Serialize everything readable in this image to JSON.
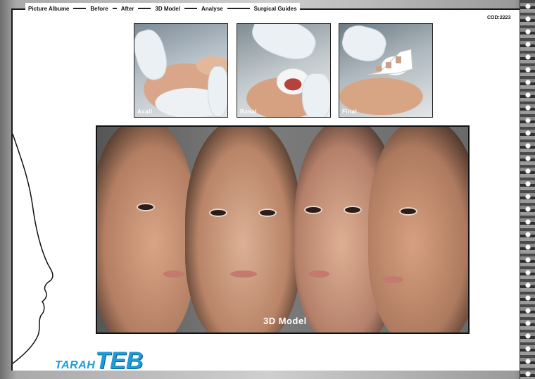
{
  "nav": {
    "items": [
      "Picture Albume",
      "Before",
      "After",
      "3D Model",
      "Analyse",
      "Surgical Guides"
    ]
  },
  "code": "COD:2223",
  "thumbnails": [
    {
      "caption": "Axail"
    },
    {
      "caption": "Basal"
    },
    {
      "caption": "Final"
    }
  ],
  "model": {
    "caption": "3D Model"
  },
  "logo": {
    "small": "TARAH",
    "big": "TEB"
  },
  "colors": {
    "accent": "#1e9bd7",
    "frame": "#111111"
  }
}
